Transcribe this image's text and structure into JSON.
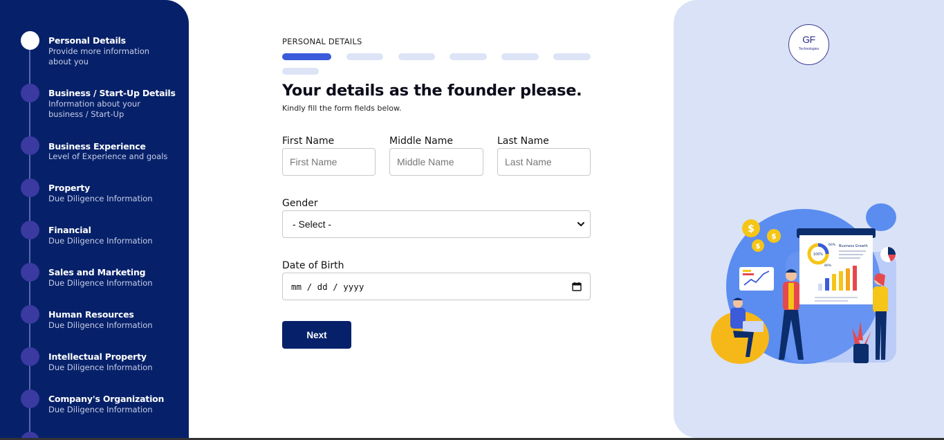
{
  "sidebar": {
    "steps": [
      {
        "title": "Personal Details",
        "desc": "Provide more information about you",
        "active": true
      },
      {
        "title": "Business / Start-Up Details",
        "desc": "Information about your business / Start-Up"
      },
      {
        "title": "Business Experience",
        "desc": "Level of Experience and goals"
      },
      {
        "title": "Property",
        "desc": "Due Diligence Information"
      },
      {
        "title": "Financial",
        "desc": "Due Diligence Information"
      },
      {
        "title": "Sales and Marketing",
        "desc": "Due Diligence Information"
      },
      {
        "title": "Human Resources",
        "desc": "Due Diligence Information"
      },
      {
        "title": "Intellectual Property",
        "desc": "Due Diligence Information"
      },
      {
        "title": "Company's Organization",
        "desc": "Due Diligence Information"
      }
    ]
  },
  "form": {
    "eyebrow": "PERSONAL DETAILS",
    "progress": {
      "current": 1,
      "total": 7
    },
    "heading": "Your details as the founder please.",
    "subheading": "Kindly fill the form fields below.",
    "first_name": {
      "label": "First Name",
      "placeholder": "First Name"
    },
    "middle_name": {
      "label": "Middle Name",
      "placeholder": "Middle Name"
    },
    "last_name": {
      "label": "Last Name",
      "placeholder": "Last Name"
    },
    "gender": {
      "label": "Gender",
      "value": "- Select -"
    },
    "dob": {
      "label": "Date of Birth",
      "placeholder": "mm / dd / yyyy"
    },
    "next_label": "Next"
  },
  "brand": {
    "logo_text": "GF",
    "logo_sub": "Technologies",
    "primary": "#062169",
    "accent": "#3b5bdb",
    "panel_bg": "#dae2f7"
  },
  "illustration": {
    "chart_title": "Business Growth",
    "donut_value": "100%",
    "donut_top": "60%",
    "donut_bottom": "80%"
  }
}
